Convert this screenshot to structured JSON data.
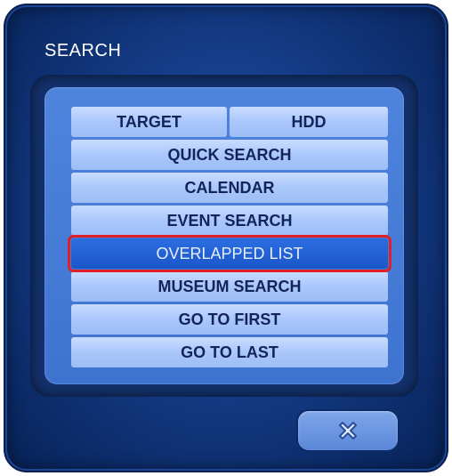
{
  "dialog": {
    "title": "SEARCH"
  },
  "menu": {
    "target_label": "TARGET",
    "target_value": "HDD",
    "items": [
      {
        "label": "QUICK SEARCH",
        "selected": false
      },
      {
        "label": "CALENDAR",
        "selected": false
      },
      {
        "label": "EVENT SEARCH",
        "selected": false
      },
      {
        "label": "OVERLAPPED LIST",
        "selected": true
      },
      {
        "label": "MUSEUM SEARCH",
        "selected": false
      },
      {
        "label": "GO TO FIRST",
        "selected": false
      },
      {
        "label": "GO TO LAST",
        "selected": false
      }
    ]
  },
  "footer": {
    "close_icon": "close-icon"
  },
  "colors": {
    "highlight_border": "#e01f26",
    "selected_row": "#1b57c8",
    "row_background": "#aac7fb"
  }
}
